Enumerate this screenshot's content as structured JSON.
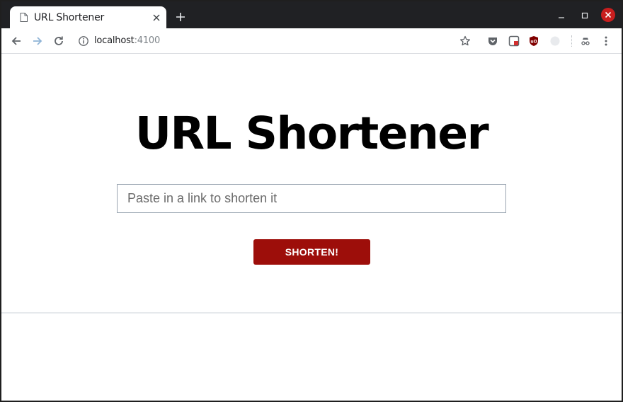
{
  "browser": {
    "tab": {
      "title": "URL Shortener",
      "favicon_icon": "document-icon",
      "close_icon": "close-icon"
    },
    "new_tab_icon": "plus-icon",
    "window_controls": [
      "minimize-icon",
      "maximize-icon",
      "close-icon"
    ],
    "nav": {
      "back_icon": "arrow-left-icon",
      "forward_icon": "arrow-right-icon",
      "reload_icon": "reload-icon"
    },
    "address": {
      "info_icon": "info-icon",
      "host": "localhost",
      "port": ":4100"
    },
    "toolbar_icons": [
      "star-icon",
      "pocket-icon",
      "extension-icon",
      "ublock-icon",
      "moon-icon",
      "incognito-icon",
      "kebab-menu-icon"
    ],
    "accent_close": "#c81e1e"
  },
  "app": {
    "title": "URL Shortener",
    "input_placeholder": "Paste in a link to shorten it",
    "button_label": "SHORTEN!",
    "button_color": "#9d0e0a"
  }
}
